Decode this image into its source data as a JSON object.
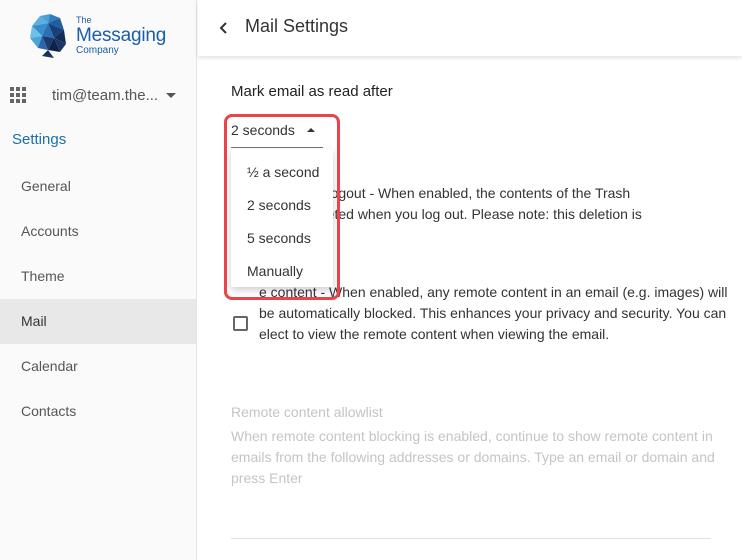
{
  "logo": {
    "line1": "The",
    "line2": "Messaging",
    "line3": "Company"
  },
  "account": {
    "email": "tim@team.the..."
  },
  "sidebar": {
    "heading": "Settings",
    "items": [
      {
        "label": "General"
      },
      {
        "label": "Accounts"
      },
      {
        "label": "Theme"
      },
      {
        "label": "Mail",
        "active": true
      },
      {
        "label": "Calendar"
      },
      {
        "label": "Contacts"
      }
    ]
  },
  "header": {
    "title": "Mail Settings"
  },
  "mark_read": {
    "title": "Mark email as read after",
    "selected": "2 seconds",
    "options": [
      "½ a second",
      "2 seconds",
      "5 seconds",
      "Manually"
    ]
  },
  "trash": {
    "text_line1": "on logout - When enabled, the contents of the Trash",
    "text_line2": "deleted when you log out. Please note: this deletion is"
  },
  "remote": {
    "text": "e content - When enabled, any remote content in an email (e.g. images) will be automatically blocked. This enhances your privacy and security. You can elect to view the remote content when viewing the email."
  },
  "allowlist": {
    "title": "Remote content allowlist",
    "description": "When remote content blocking is enabled, continue to show remote content in emails from the following addresses or domains. Type an email or domain and press Enter"
  },
  "colors": {
    "accent": "#1a6fa8",
    "highlight": "#e8444a"
  }
}
